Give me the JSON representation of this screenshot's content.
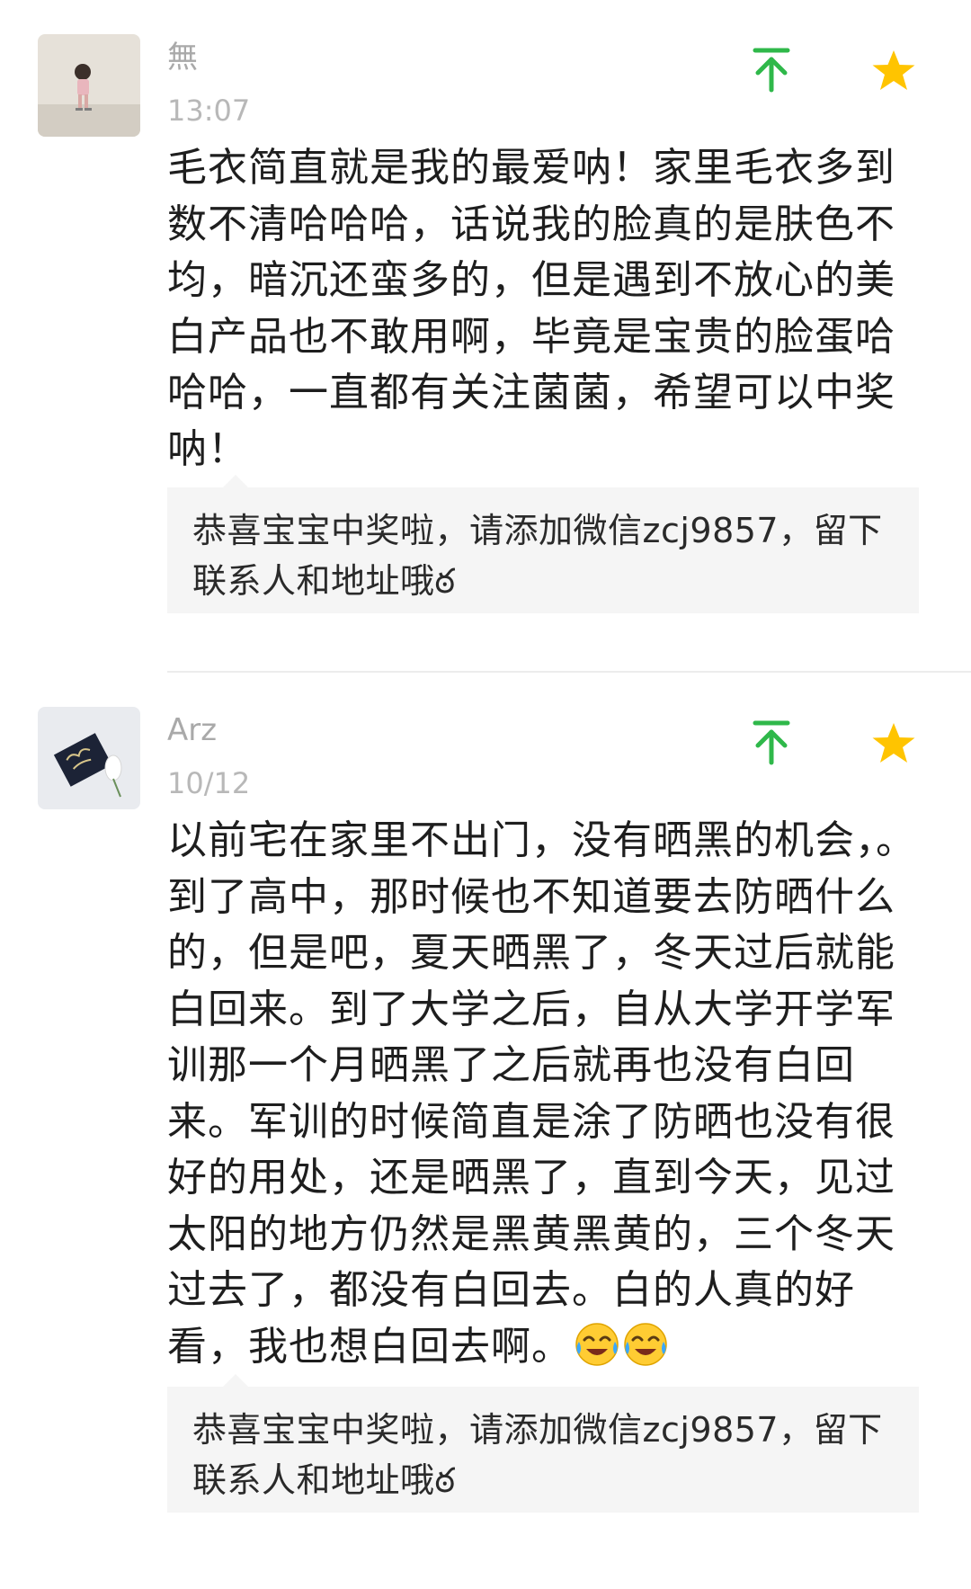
{
  "comments": [
    {
      "username": "無",
      "time": "13:07",
      "content": "毛衣简直就是我的最爱呐！家里毛衣多到数不清哈哈哈，话说我的脸真的是肤色不均，暗沉还蛮多的，但是遇到不放心的美白产品也不敢用啊，毕竟是宝贵的脸蛋哈哈哈，一直都有关注菌菌，希望可以中奖呐！",
      "reply": "恭喜宝宝中奖啦，请添加微信zcj9857，留下联系人和地址哦ఠ"
    },
    {
      "username": "Arz",
      "time": "10/12",
      "content": "以前宅在家里不出门，没有晒黑的机会，。到了高中，那时候也不知道要去防晒什么的，但是吧，夏天晒黑了，冬天过后就能白回来。到了大学之后，自从大学开学军训那一个月晒黑了之后就再也没有白回来。军训的时候简直是涂了防晒也没有很好的用处，还是晒黑了，直到今天，见过太阳的地方仍然是黑黄黑黄的，三个冬天过去了，都没有白回去。白的人真的好看，我也想白回去啊。",
      "content_emojis": [
        "crying-laughing-emoji",
        "crying-laughing-emoji"
      ],
      "reply": "恭喜宝宝中奖啦，请添加微信zcj9857，留下联系人和地址哦ఠ"
    }
  ],
  "icons": {
    "upvote": "upvote-arrow-icon",
    "star": "star-icon"
  },
  "colors": {
    "upvote_green": "#2fb84a",
    "star_yellow": "#ffc400",
    "username_gray": "#a9a9a9",
    "reply_bg": "#f5f5f5"
  }
}
